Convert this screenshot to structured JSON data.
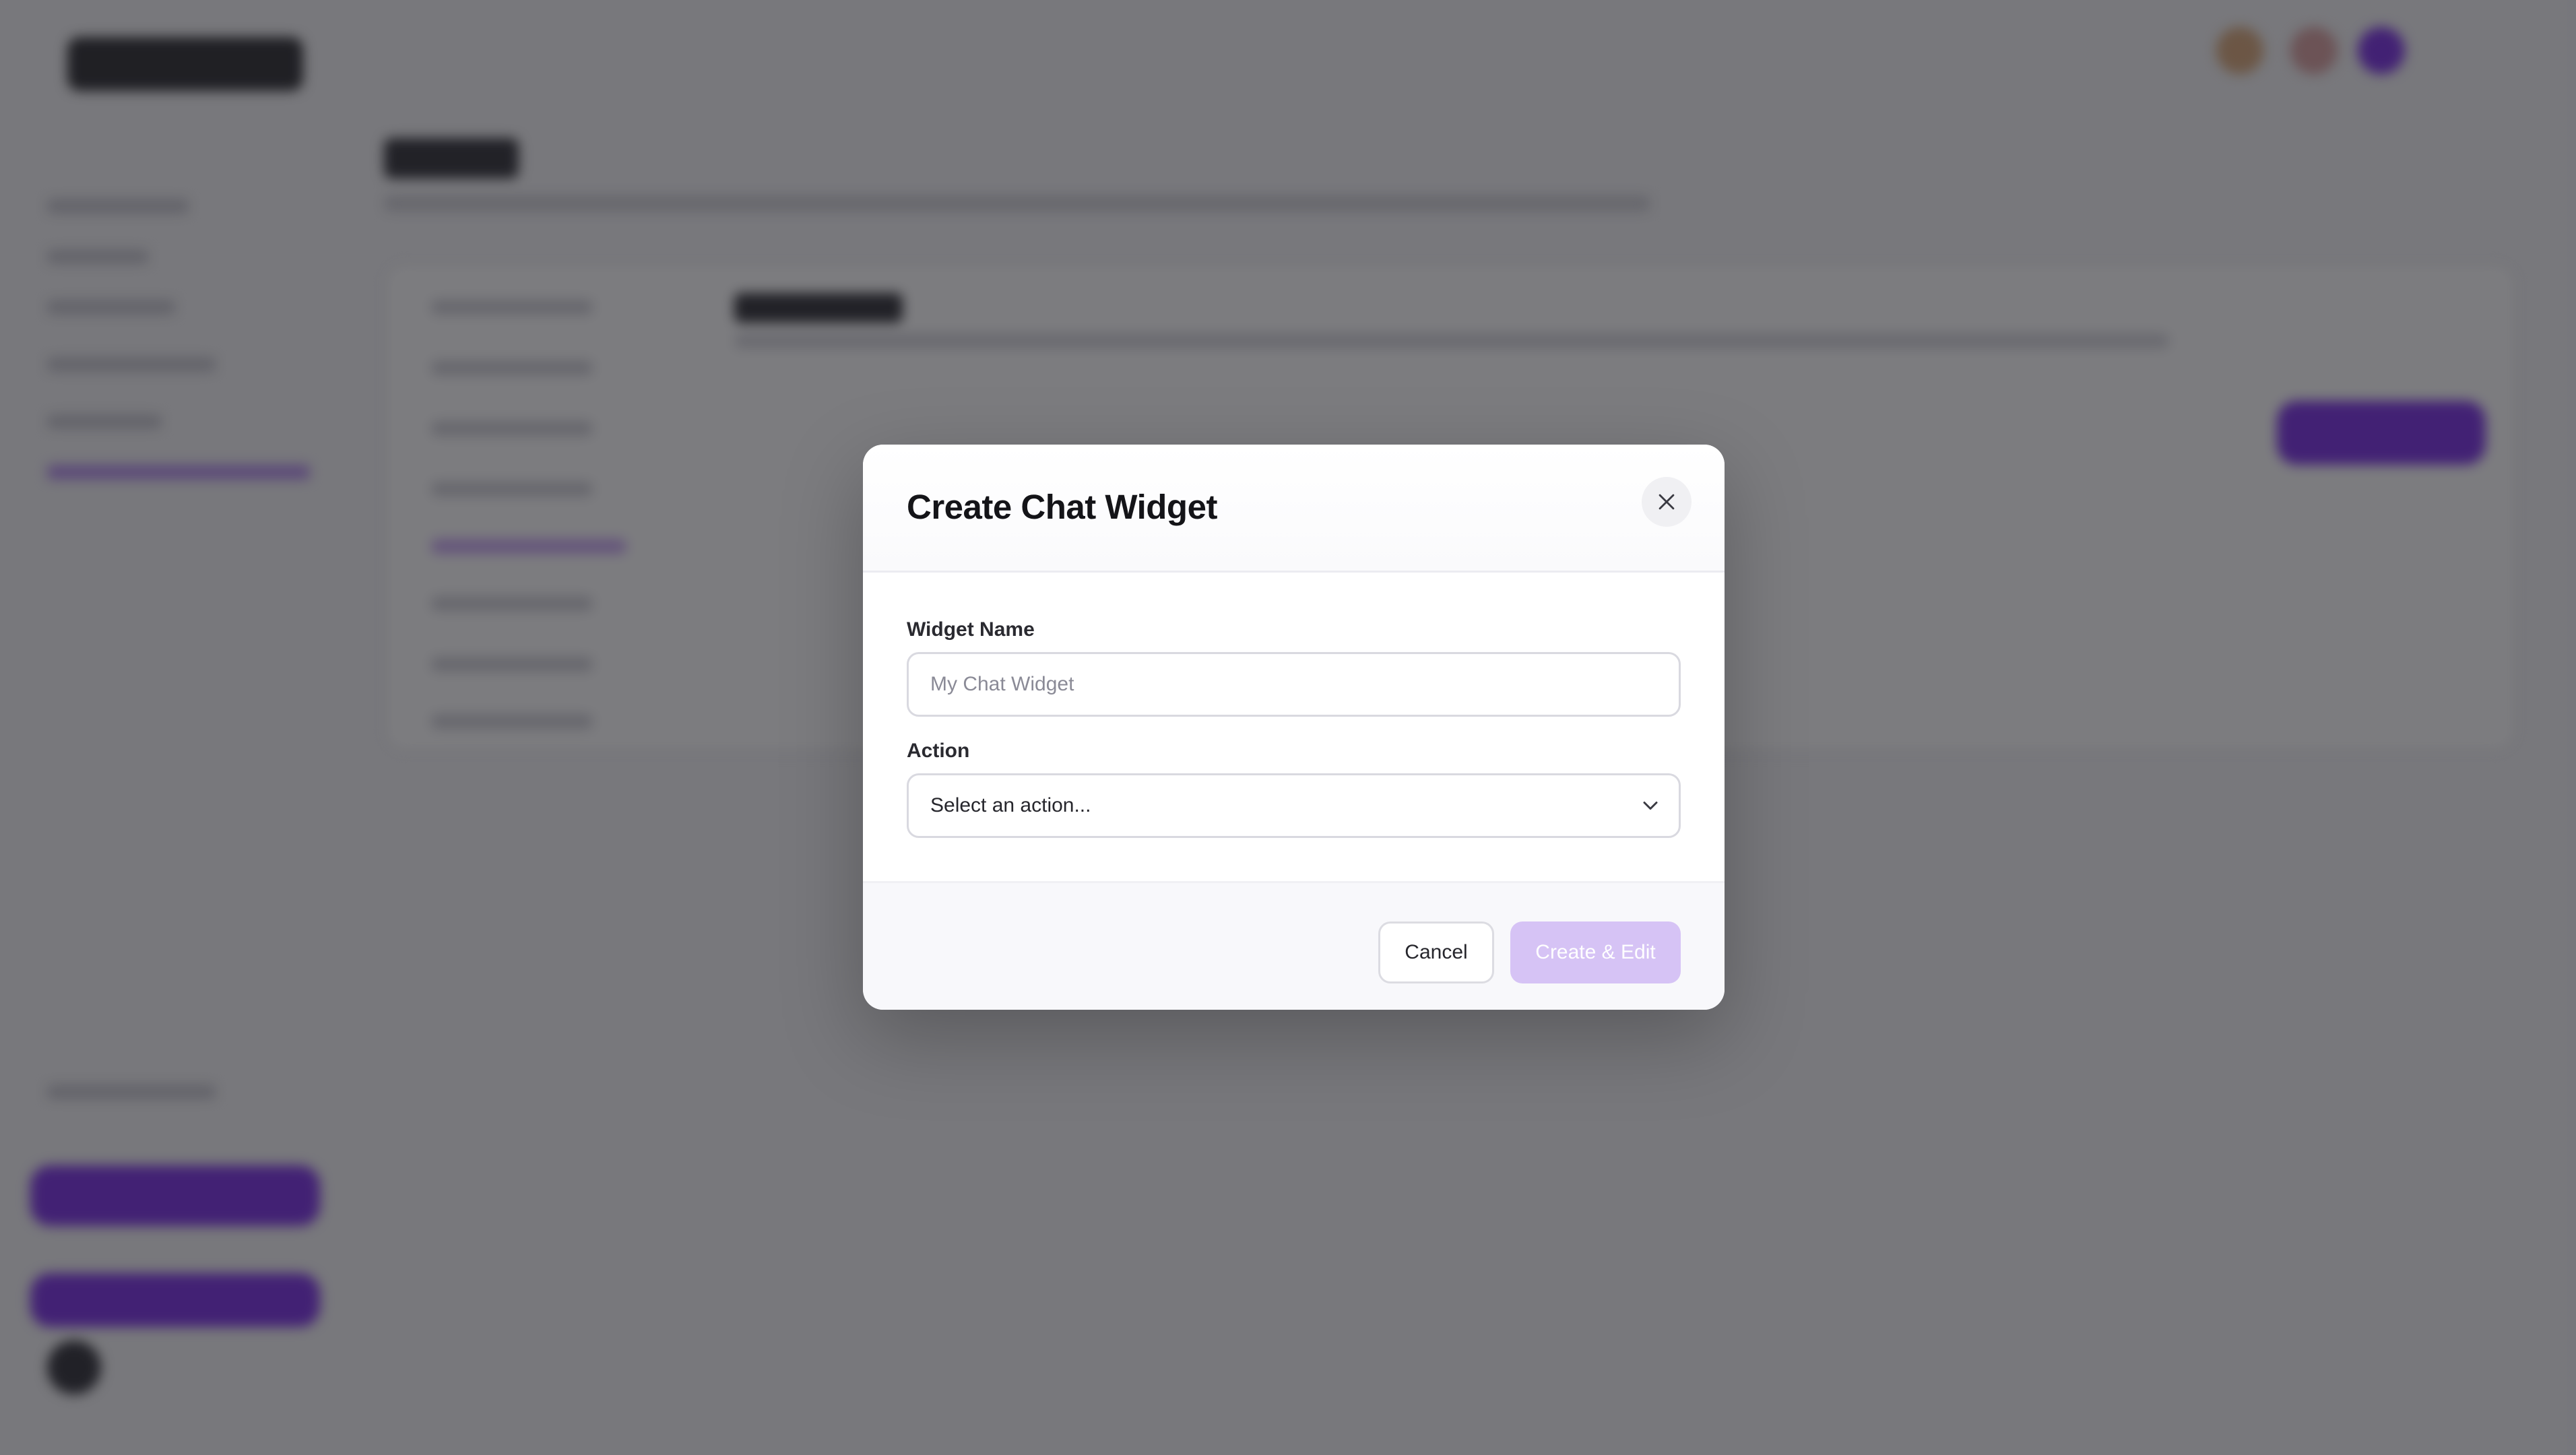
{
  "modal": {
    "title": "Create Chat Widget",
    "widget_name_label": "Widget Name",
    "widget_name_placeholder": "My Chat Widget",
    "widget_name_value": "",
    "action_label": "Action",
    "action_selected": "Select an action...",
    "cancel_label": "Cancel",
    "create_label": "Create & Edit",
    "create_enabled": false
  },
  "icons": {
    "close": "close-icon",
    "chevron": "chevron-down-icon"
  },
  "colors": {
    "accent": "#7a2ee6",
    "accent_disabled": "#d6c3f5",
    "overlay": "rgba(24,24,30,0.57)"
  }
}
